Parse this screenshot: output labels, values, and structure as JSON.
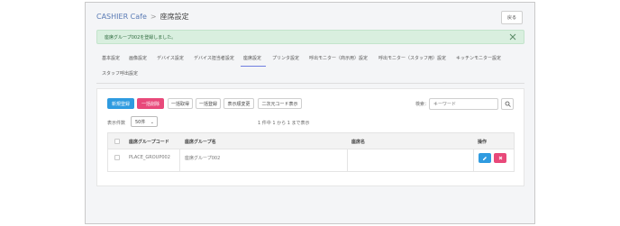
{
  "header": {
    "brand": "CASHIER Cafe",
    "separator": ">",
    "page_title": "座席設定",
    "back_label": "戻る"
  },
  "alert": {
    "message": "座席グループ002を登録しました。"
  },
  "tabs": [
    {
      "label": "基本設定"
    },
    {
      "label": "画像設定"
    },
    {
      "label": "デバイス設定"
    },
    {
      "label": "デバイス担当者設定"
    },
    {
      "label": "座席設定",
      "active": true
    },
    {
      "label": "プリンタ設定"
    },
    {
      "label": "呼出モニター（商示用）設定"
    },
    {
      "label": "呼出モニター（スタッフ用）設定"
    },
    {
      "label": "キッチンモニター設定"
    },
    {
      "label": "スタッフ呼出設定"
    }
  ],
  "toolbar": {
    "new_label": "新規登録",
    "bulk_delete_label": "一括削除",
    "bulk_fetch_label": "一括取得",
    "bulk_register_label": "一括登録",
    "reorder_label": "表示順変更",
    "qr_label": "二次元コード表示"
  },
  "search": {
    "label": "検索：",
    "placeholder": "キーワード"
  },
  "paging": {
    "count_label": "表示件数",
    "per_page": "50件",
    "range_info": "1 件中 1 から 1 まで表示"
  },
  "table": {
    "columns": [
      "座席グループコード",
      "座席グループ名",
      "座席名",
      "操作"
    ],
    "rows": [
      {
        "code": "PLACE_GROUP002",
        "name": "座席グループ002",
        "seat": ""
      }
    ]
  },
  "colors": {
    "primary": "#2f9be0",
    "danger": "#e8497a",
    "success_bg": "#d9efdf",
    "tab_active": "#6f7de0"
  }
}
